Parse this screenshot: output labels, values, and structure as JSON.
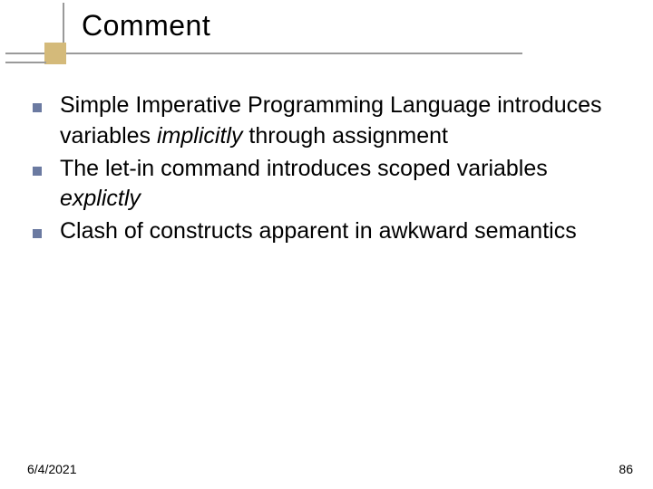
{
  "title": "Comment",
  "bullets": [
    {
      "pre": "Simple Imperative Programming Language introduces variables ",
      "em": "implicitly",
      "post": " through assignment"
    },
    {
      "pre": "The let-in command introduces scoped variables ",
      "em": "explictly",
      "post": ""
    },
    {
      "pre": "Clash of constructs apparent in awkward semantics",
      "em": "",
      "post": ""
    }
  ],
  "footer": {
    "date": "6/4/2021",
    "page": "86"
  },
  "colors": {
    "bullet": "#6b7aa1",
    "accent_square": "#d4ba7a",
    "lines": "#9a9a9a"
  }
}
